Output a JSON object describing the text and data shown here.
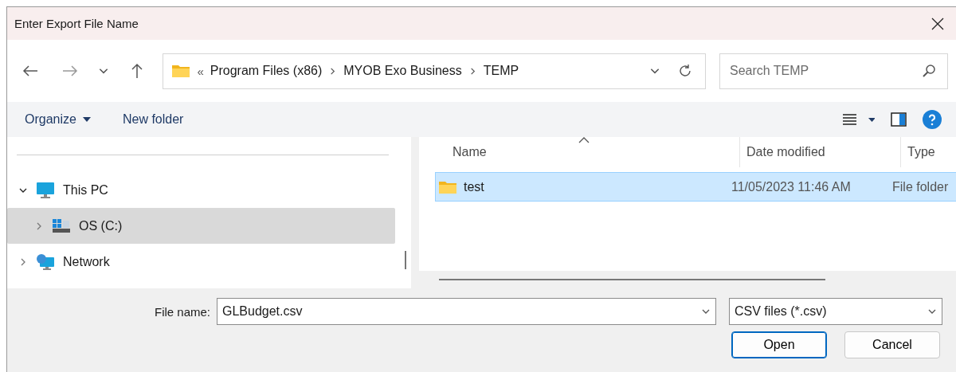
{
  "window": {
    "title": "Enter Export File Name"
  },
  "address_bar": {
    "overflow": "«",
    "path": [
      "Program Files (x86)",
      "MYOB Exo Business",
      "TEMP"
    ]
  },
  "search": {
    "placeholder": "Search TEMP"
  },
  "command_bar": {
    "organize": "Organize",
    "new_folder": "New folder"
  },
  "tree": [
    {
      "label": "This PC",
      "kind": "computer",
      "expanded": true,
      "selected": false,
      "children": [
        {
          "label": "OS (C:)",
          "kind": "drive",
          "expanded": false,
          "selected": true
        }
      ]
    },
    {
      "label": "Network",
      "kind": "network",
      "expanded": false,
      "selected": false
    }
  ],
  "table": {
    "columns": [
      {
        "label": "Name",
        "sorted": true
      },
      {
        "label": "Date modified"
      },
      {
        "label": "Type"
      }
    ],
    "rows": [
      {
        "name": "test",
        "date_modified": "11/05/2023 11:46 AM",
        "type": "File folder",
        "selected": true
      }
    ]
  },
  "footer": {
    "file_name_label": "File name:",
    "file_name": "GLBudget.csv",
    "file_type": "CSV files (*.csv)",
    "buttons": [
      {
        "label": "Open",
        "default": true
      },
      {
        "label": "Cancel",
        "default": false
      }
    ]
  }
}
